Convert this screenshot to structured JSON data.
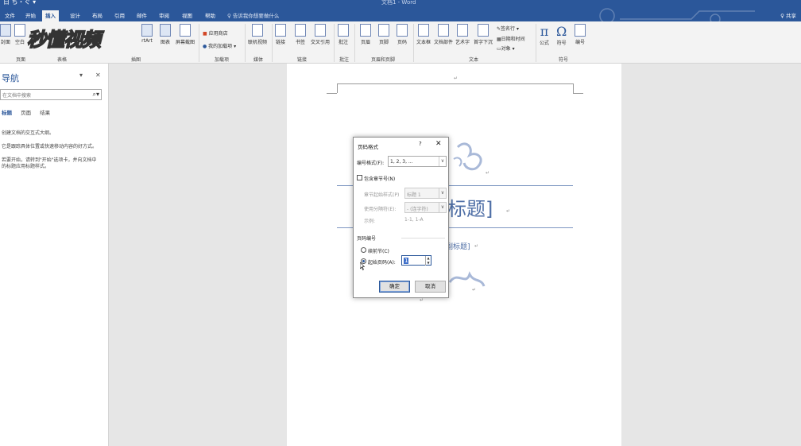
{
  "titlebar": {
    "quick_access": "日 ち・ぐ ▾",
    "doc_title": "文档1 - Word"
  },
  "tabs": [
    {
      "label": "文件"
    },
    {
      "label": "开始"
    },
    {
      "label": "插入"
    },
    {
      "label": "设计"
    },
    {
      "label": "布局"
    },
    {
      "label": "引用"
    },
    {
      "label": "邮件"
    },
    {
      "label": "审阅"
    },
    {
      "label": "视图"
    },
    {
      "label": "帮助"
    }
  ],
  "tellme": "♀ 告诉我你想要做什么",
  "share": "♀ 共享",
  "watermark": "秒懂视频",
  "ribbon": {
    "groups": {
      "pages": "页面",
      "tables": "表格",
      "illustrations": "插图",
      "addins": "加载项",
      "media": "媒体",
      "links": "链接",
      "comments": "批注",
      "header_footer": "页眉和页脚",
      "text": "文本",
      "symbols": "符号"
    },
    "buttons": {
      "cover": "封面",
      "blank": "空白",
      "smartart": "rtArt",
      "chart": "图表",
      "screenshot": "屏幕截图",
      "store": "应用商店",
      "my_addins": "我的加载项",
      "online_video": "联机视频",
      "link": "链接",
      "bookmark": "书签",
      "crossref": "交叉引用",
      "comment": "批注",
      "header": "页眉",
      "footer": "页脚",
      "page_number": "页码",
      "textbox": "文本框",
      "quickparts": "文档部件",
      "wordart": "艺术字",
      "dropcap": "首字下沉",
      "signature": "签名行",
      "datetime": "日期和时间",
      "object": "对象",
      "equation": "公式",
      "symbol": "符号",
      "number": "编号"
    }
  },
  "nav": {
    "title": "导航",
    "search_placeholder": "在文档中搜索",
    "tabs": [
      "标题",
      "页面",
      "结果"
    ],
    "lines": [
      "创建文档的交互式大纲。",
      "它是跟踪具体位置或快速移动内容的好方式。",
      "若要开始，请转到\"开始\"选项卡，并向文档中",
      "的标题应用标题样式。"
    ]
  },
  "document": {
    "title": "标题]",
    "subtitle": "副标题]",
    "para_mark": "↵"
  },
  "dialog": {
    "title": "页码格式",
    "help": "?",
    "close": "✕",
    "number_format_label": "编号格式(F):",
    "number_format_value": "1, 2, 3, ...",
    "include_chapter_label": "包含章节号(N)",
    "chapter_style_label": "章节起始样式(P)",
    "chapter_style_value": "标题 1",
    "separator_label": "使用分隔符(E):",
    "separator_value": "- (连字符)",
    "example_label": "示例:",
    "example_value": "1-1, 1-A",
    "page_numbering_label": "页码编号",
    "continue_label": "续前节(C)",
    "start_at_label": "起始页码(A):",
    "start_at_value": "1",
    "ok": "确定",
    "cancel": "取消"
  }
}
